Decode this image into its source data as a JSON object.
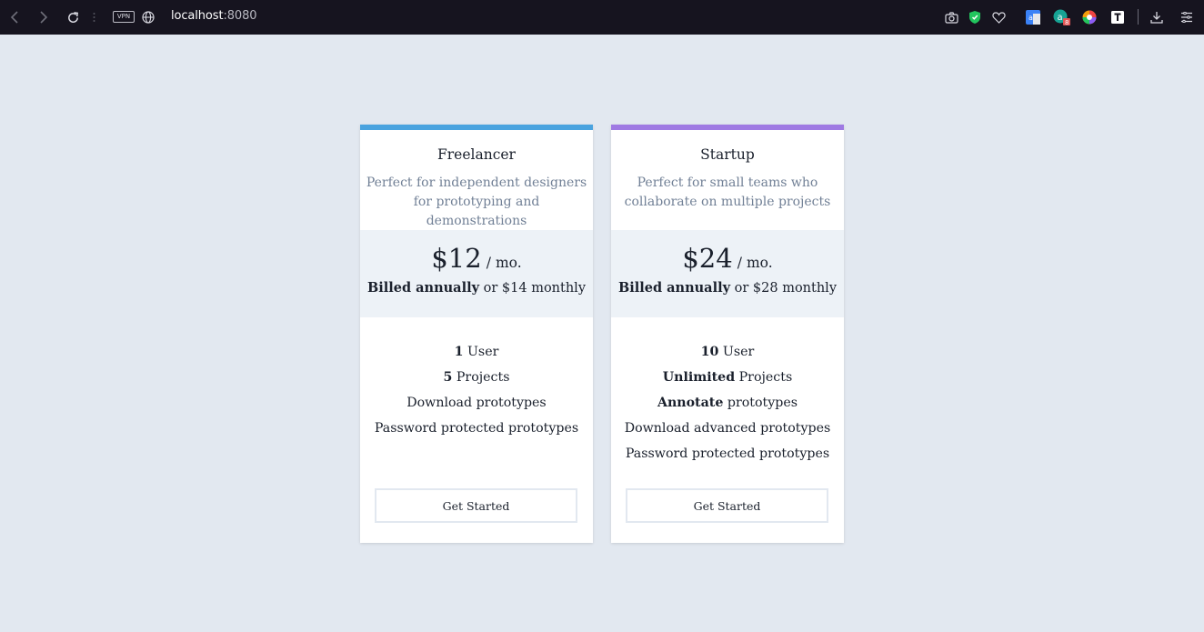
{
  "browser": {
    "url_host": "localhost",
    "url_port": ":8080",
    "vpn_label": "VPN"
  },
  "plans": [
    {
      "name": "Freelancer",
      "description": "Perfect for independent designers for prototyping and demonstrations",
      "price": "$12",
      "period": "/ mo.",
      "billed_strong": "Billed annually",
      "billed_rest": " or $14 monthly",
      "features": [
        {
          "strong": "1",
          "rest": " User"
        },
        {
          "strong": "5",
          "rest": " Projects"
        },
        {
          "strong": "",
          "rest": "Download prototypes"
        },
        {
          "strong": "",
          "rest": "Password protected prototypes"
        }
      ],
      "cta": "Get Started",
      "accent": "#4aa3df"
    },
    {
      "name": "Startup",
      "description": "Perfect for small teams who collaborate on multiple projects",
      "price": "$24",
      "period": "/ mo.",
      "billed_strong": "Billed annually",
      "billed_rest": " or $28 monthly",
      "features": [
        {
          "strong": "10",
          "rest": " User"
        },
        {
          "strong": "Unlimited",
          "rest": " Projects"
        },
        {
          "strong": "Annotate",
          "rest": " prototypes"
        },
        {
          "strong": "",
          "rest": "Download advanced prototypes"
        },
        {
          "strong": "",
          "rest": "Password protected prototypes"
        }
      ],
      "cta": "Get Started",
      "accent": "#9f7ae3"
    }
  ],
  "toolbar_icons": [
    "back-icon",
    "forward-icon",
    "reload-icon",
    "globe-icon",
    "camera-icon",
    "shield-icon",
    "heart-icon",
    "translate-icon",
    "extension-icon",
    "color-wheel-icon",
    "reader-icon",
    "download-icon",
    "menu-icon"
  ]
}
